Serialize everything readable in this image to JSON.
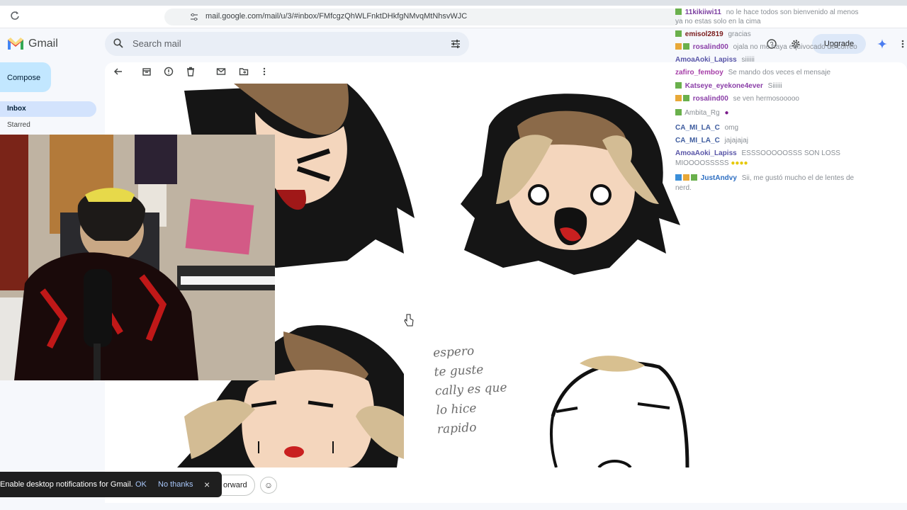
{
  "browser": {
    "url": "mail.google.com/mail/u/3/#inbox/FMfcgzQhWLFnktDHkfgNMvqMtNhsvWJC"
  },
  "gmail": {
    "brand": "Gmail",
    "search_placeholder": "Search mail",
    "compose_label": "Compose",
    "nav": [
      {
        "label": "Inbox"
      },
      {
        "label": "Starred"
      }
    ],
    "upgrade_label": "Upgrade",
    "forward_label": "orward",
    "colors": {
      "accent": "#c2e7ff",
      "selected": "#d3e3fd",
      "gmail_red": "#ea4335"
    }
  },
  "email": {
    "handwritten_note": [
      "espero",
      "te guste",
      "cally es que",
      "lo hice",
      "rapido"
    ]
  },
  "notification": {
    "text": "Enable desktop notifications for Gmail.",
    "ok": "OK",
    "no_thanks": "No thanks",
    "close_icon": "×"
  },
  "chat": {
    "messages": [
      {
        "user": "11kikiiwi11",
        "text": "no le hace todos son bienvenido al menos",
        "color": "#7b3fa0"
      },
      {
        "user": "",
        "text": "ya no estas solo en la cima",
        "color": "#8a8f95"
      },
      {
        "user": "emisol2819",
        "text": "gracias",
        "color": "#7b1c1c"
      },
      {
        "user": "rosalind00",
        "text": "ojala no me haya equivocado de correo",
        "color": "#8b3fa8"
      },
      {
        "user": "AmoaAoki_Lapiss",
        "text": "siiiiii",
        "color": "#5a56a8"
      },
      {
        "user": "zafiro_femboy",
        "text": "Se mando dos veces el mensaje",
        "color": "#a63fa8"
      },
      {
        "user": "Katseye_eyekone4ever",
        "text": "Siiiiii",
        "color": "#8b3fa8"
      },
      {
        "user": "rosalind00",
        "text": "se ven hermosooooo",
        "color": "#8b3fa8"
      },
      {
        "user": "Ambita_Rg",
        "text": "",
        "color": "#8a8f95"
      },
      {
        "user": "CA_MI_LA_C",
        "text": "omg",
        "color": "#3d5b9e"
      },
      {
        "user": "CA_MI_LA_C",
        "text": "jajajajaj",
        "color": "#3d5b9e"
      },
      {
        "user": "AmoaAoki_Lapiss",
        "text": "ESSSOOOOOSSS SON LOSS",
        "color": "#5a56a8"
      },
      {
        "user": "",
        "text": "MIOOOOSSSSS",
        "color": "#8a8f95"
      },
      {
        "user": "JustAndvy",
        "text": "Sii, me gustó mucho el de lentes de",
        "color": "#2e6fc2"
      },
      {
        "user": "",
        "text": "nerd.",
        "color": "#8a8f95"
      }
    ]
  },
  "icons": {
    "search": "search-icon",
    "filter": "tune-icon",
    "back": "arrow-left-icon",
    "archive": "archive-icon",
    "spam": "report-icon",
    "delete": "trash-icon",
    "unread": "mail-icon",
    "move": "folder-icon",
    "more": "more-vert-icon",
    "help": "help-icon",
    "settings": "gear-icon",
    "emoji": "emoji-icon"
  }
}
